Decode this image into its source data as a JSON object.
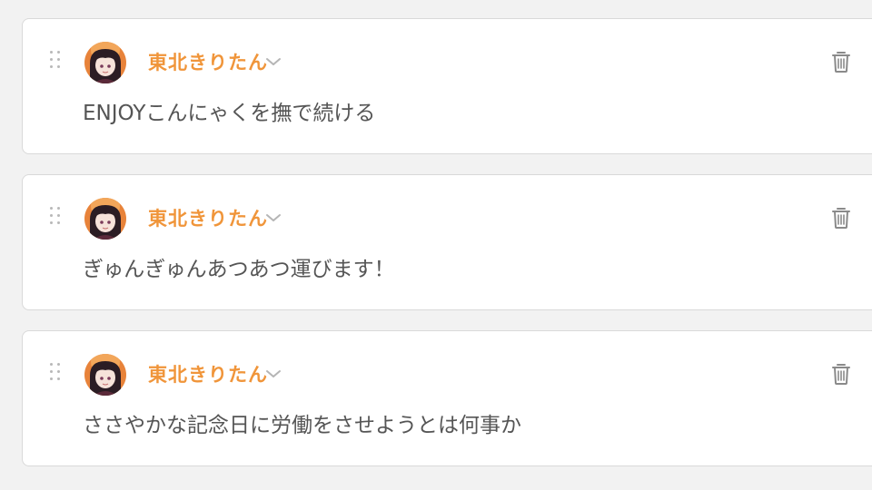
{
  "script_lines": [
    {
      "speaker": "東北きりたん",
      "text": "ENJOYこんにゃくを撫で続ける"
    },
    {
      "speaker": "東北きりたん",
      "text": "ぎゅんぎゅんあつあつ運びます！"
    },
    {
      "speaker": "東北きりたん",
      "text": "ささやかな記念日に労働をさせようとは何事か"
    }
  ],
  "icons": {
    "drag": "drag-handle-icon",
    "avatar": "avatar",
    "dropdown": "chevron-down-icon",
    "delete": "trash-icon"
  },
  "colors": {
    "speaker_name": "#f0953a",
    "text": "#555555",
    "card_border": "#d9d9d9",
    "background": "#f2f2f2"
  }
}
